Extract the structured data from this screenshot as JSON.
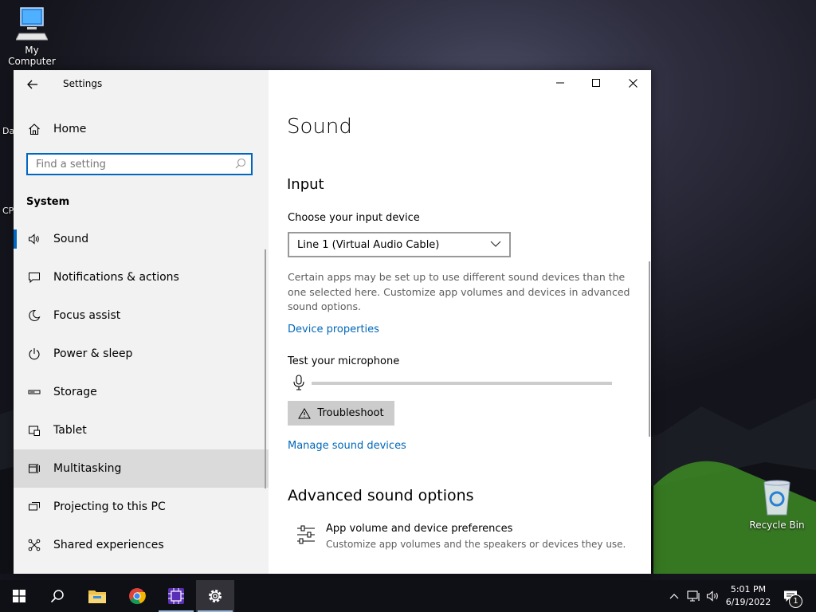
{
  "desktop": {
    "icons": [
      {
        "label": "My Computer",
        "icon": "computer-icon"
      },
      {
        "label": "Recycle Bin",
        "icon": "recycle-bin-icon"
      }
    ],
    "partial_labels": [
      "Da",
      "CP"
    ]
  },
  "window": {
    "app_title": "Settings",
    "back_icon": "back-arrow-icon",
    "controls": [
      "minimize",
      "maximize",
      "close"
    ]
  },
  "sidebar": {
    "home_label": "Home",
    "search_placeholder": "Find a setting",
    "search_value": "",
    "section_title": "System",
    "items": [
      {
        "label": "Sound",
        "icon": "speaker-icon",
        "selected": true
      },
      {
        "label": "Notifications & actions",
        "icon": "notification-icon"
      },
      {
        "label": "Focus assist",
        "icon": "moon-icon"
      },
      {
        "label": "Power & sleep",
        "icon": "power-icon"
      },
      {
        "label": "Storage",
        "icon": "storage-icon"
      },
      {
        "label": "Tablet",
        "icon": "tablet-icon"
      },
      {
        "label": "Multitasking",
        "icon": "multitasking-icon",
        "hover": true
      },
      {
        "label": "Projecting to this PC",
        "icon": "projecting-icon"
      },
      {
        "label": "Shared experiences",
        "icon": "shared-experiences-icon"
      }
    ]
  },
  "content": {
    "title": "Sound",
    "input_heading": "Input",
    "choose_device_label": "Choose your input device",
    "input_device_selected": "Line 1 (Virtual Audio Cable)",
    "help_text": "Certain apps may be set up to use different sound devices than the one selected here. Customize app volumes and devices in advanced sound options.",
    "device_properties_link": "Device properties",
    "test_mic_label": "Test your microphone",
    "mic_level": 0,
    "troubleshoot_label": "Troubleshoot",
    "manage_devices_link": "Manage sound devices",
    "advanced_heading": "Advanced sound options",
    "app_volume_title": "App volume and device preferences",
    "app_volume_subtitle": "Customize app volumes and the speakers or devices they use."
  },
  "taskbar": {
    "apps": [
      "start",
      "search",
      "file-explorer",
      "chrome",
      "app",
      "settings"
    ],
    "active_app": "settings",
    "time": "5:01 PM",
    "date": "6/19/2022",
    "notification_count": "1"
  },
  "colors": {
    "accent": "#0067c0",
    "link": "#0067b8",
    "sidebar_bg": "#f2f2f2"
  }
}
